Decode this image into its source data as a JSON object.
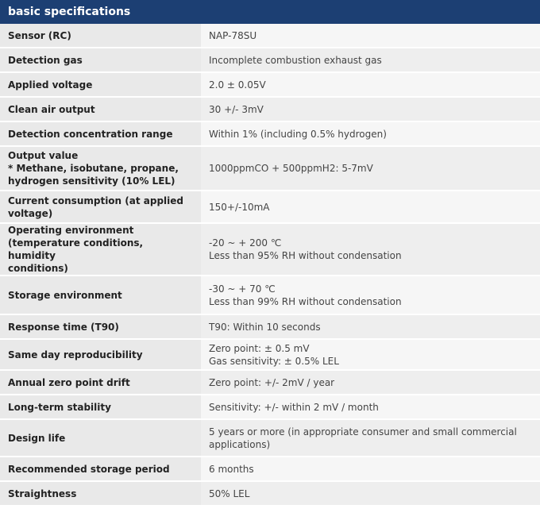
{
  "header": {
    "title": "basic specifications"
  },
  "rows": [
    {
      "label": [
        "Sensor (RC)"
      ],
      "value": [
        "NAP-78SU"
      ]
    },
    {
      "label": [
        "Detection gas"
      ],
      "value": [
        "Incomplete combustion exhaust gas"
      ]
    },
    {
      "label": [
        "Applied voltage"
      ],
      "value": [
        "2.0 ± 0.05V"
      ]
    },
    {
      "label": [
        "Clean air output"
      ],
      "value": [
        "30 +/- 3mV"
      ]
    },
    {
      "label": [
        "Detection concentration range"
      ],
      "value": [
        "Within 1% (including 0.5% hydrogen)"
      ]
    },
    {
      "label": [
        "Output value",
        "* Methane, isobutane, propane,",
        "hydrogen sensitivity (10% LEL)"
      ],
      "value": [
        "1000ppmCO + 500ppmH2: 5-7mV"
      ]
    },
    {
      "label": [
        "Current consumption (at applied",
        "voltage)"
      ],
      "value": [
        "150+/-10mA"
      ]
    },
    {
      "label": [
        "Operating environment",
        "(temperature conditions, humidity",
        "conditions)"
      ],
      "value": [
        "-20 ~ + 200 ℃",
        "Less than 95% RH without condensation"
      ]
    },
    {
      "label": [
        "Storage environment"
      ],
      "value": [
        "-30 ~ + 70 ℃",
        "Less than 99% RH without condensation"
      ]
    },
    {
      "label": [
        "Response time (T90)"
      ],
      "value": [
        "T90: Within 10 seconds"
      ]
    },
    {
      "label": [
        "Same day reproducibility"
      ],
      "value": [
        "Zero point: ± 0.5 mV",
        "Gas sensitivity: ± 0.5% LEL"
      ]
    },
    {
      "label": [
        "Annual zero point drift"
      ],
      "value": [
        "Zero point: +/- 2mV / year"
      ]
    },
    {
      "label": [
        "Long-term stability"
      ],
      "value": [
        "Sensitivity: +/- within 2 mV / month"
      ]
    },
    {
      "label": [
        "Design life"
      ],
      "value": [
        "5 years or more (in appropriate consumer and small commercial",
        "applications)"
      ]
    },
    {
      "label": [
        "Recommended storage period"
      ],
      "value": [
        "6 months"
      ]
    },
    {
      "label": [
        "Straightness"
      ],
      "value": [
        "50% LEL"
      ]
    }
  ]
}
